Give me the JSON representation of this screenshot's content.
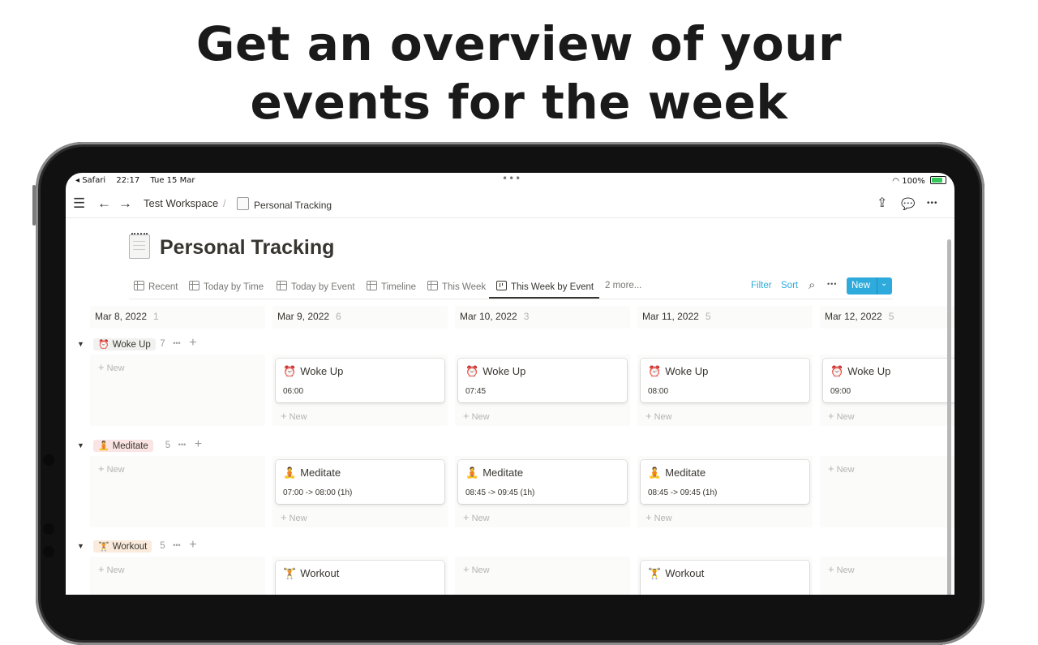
{
  "headline": {
    "line1": "Get an overview of your",
    "line2": "events for the week"
  },
  "status_bar": {
    "app": "◂ Safari",
    "time": "22:17",
    "date": "Tue 15 Mar",
    "dots": "•••",
    "battery": "100%"
  },
  "topbar": {
    "menu_icon": "☰",
    "back_icon": "←",
    "forward_icon": "→",
    "workspace": "Test Workspace",
    "separator": "/",
    "page": "Personal Tracking",
    "share_icon": "⇪",
    "comment_icon": "💬",
    "more_icon": "•••"
  },
  "page": {
    "title": "Personal Tracking"
  },
  "views": {
    "tabs": [
      "Recent",
      "Today by Time",
      "Today by Event",
      "Timeline",
      "This Week",
      "This Week by Event"
    ],
    "more": "2 more...",
    "filter": "Filter",
    "sort": "Sort",
    "search_icon": "⌕",
    "options_icon": "•••",
    "new_label": "New",
    "new_chevron": "⌄"
  },
  "columns": [
    {
      "date": "Mar 8, 2022",
      "count": "1"
    },
    {
      "date": "Mar 9, 2022",
      "count": "6"
    },
    {
      "date": "Mar 10, 2022",
      "count": "3"
    },
    {
      "date": "Mar 11, 2022",
      "count": "5"
    },
    {
      "date": "Mar 12, 2022",
      "count": "5"
    }
  ],
  "groups": [
    {
      "name": "Woke Up",
      "emoji": "⏰",
      "count": "7",
      "tag_color": "#f1f1ef",
      "cards": [
        null,
        {
          "title": "Woke Up",
          "sub": "06:00"
        },
        {
          "title": "Woke Up",
          "sub": "07:45"
        },
        {
          "title": "Woke Up",
          "sub": "08:00"
        },
        {
          "title": "Woke Up",
          "sub": "09:00"
        }
      ]
    },
    {
      "name": "Meditate",
      "emoji": "🧘",
      "count": "5",
      "tag_color": "#fbe4e4",
      "cards": [
        null,
        {
          "title": "Meditate",
          "sub": "07:00 -> 08:00 (1h)"
        },
        {
          "title": "Meditate",
          "sub": "08:45 -> 09:45 (1h)"
        },
        {
          "title": "Meditate",
          "sub": "08:45 -> 09:45 (1h)"
        },
        null
      ]
    },
    {
      "name": "Workout",
      "emoji": "🏋",
      "count": "5",
      "tag_color": "#faebdd",
      "cards": [
        null,
        {
          "title": "Workout",
          "sub": ""
        },
        null,
        {
          "title": "Workout",
          "sub": ""
        },
        null
      ]
    }
  ],
  "add_new": {
    "plus": "+",
    "label": "New"
  },
  "group_controls": {
    "toggle": "▼",
    "dots": "•••",
    "plus": "+"
  }
}
